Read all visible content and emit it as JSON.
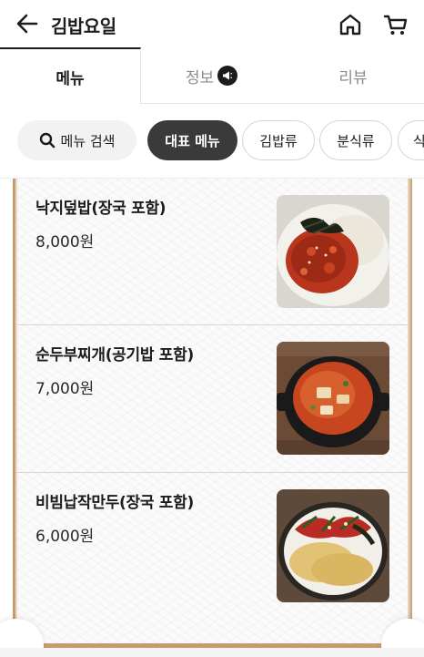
{
  "header": {
    "title": "김밥요일",
    "back_icon": "arrow-left-icon",
    "home_icon": "home-icon",
    "cart_icon": "cart-icon"
  },
  "tabs": [
    {
      "label": "메뉴",
      "active": true
    },
    {
      "label": "정보",
      "active": false,
      "icon": "announcement-icon"
    },
    {
      "label": "리뷰",
      "active": false
    }
  ],
  "filters": {
    "search_label": "메뉴 검색",
    "chips": [
      "대표 메뉴",
      "김밥류",
      "분식류",
      "식"
    ]
  },
  "menu_items": [
    {
      "name": "낙지덮밥(장국 포함)",
      "price": "8,000원"
    },
    {
      "name": "순두부찌개(공기밥 포함)",
      "price": "7,000원"
    },
    {
      "name": "비빔납작만두(장국 포함)",
      "price": "6,000원"
    }
  ],
  "colors": {
    "accent_dark": "#3a3a3a",
    "board_wood": "#c69b6d"
  }
}
